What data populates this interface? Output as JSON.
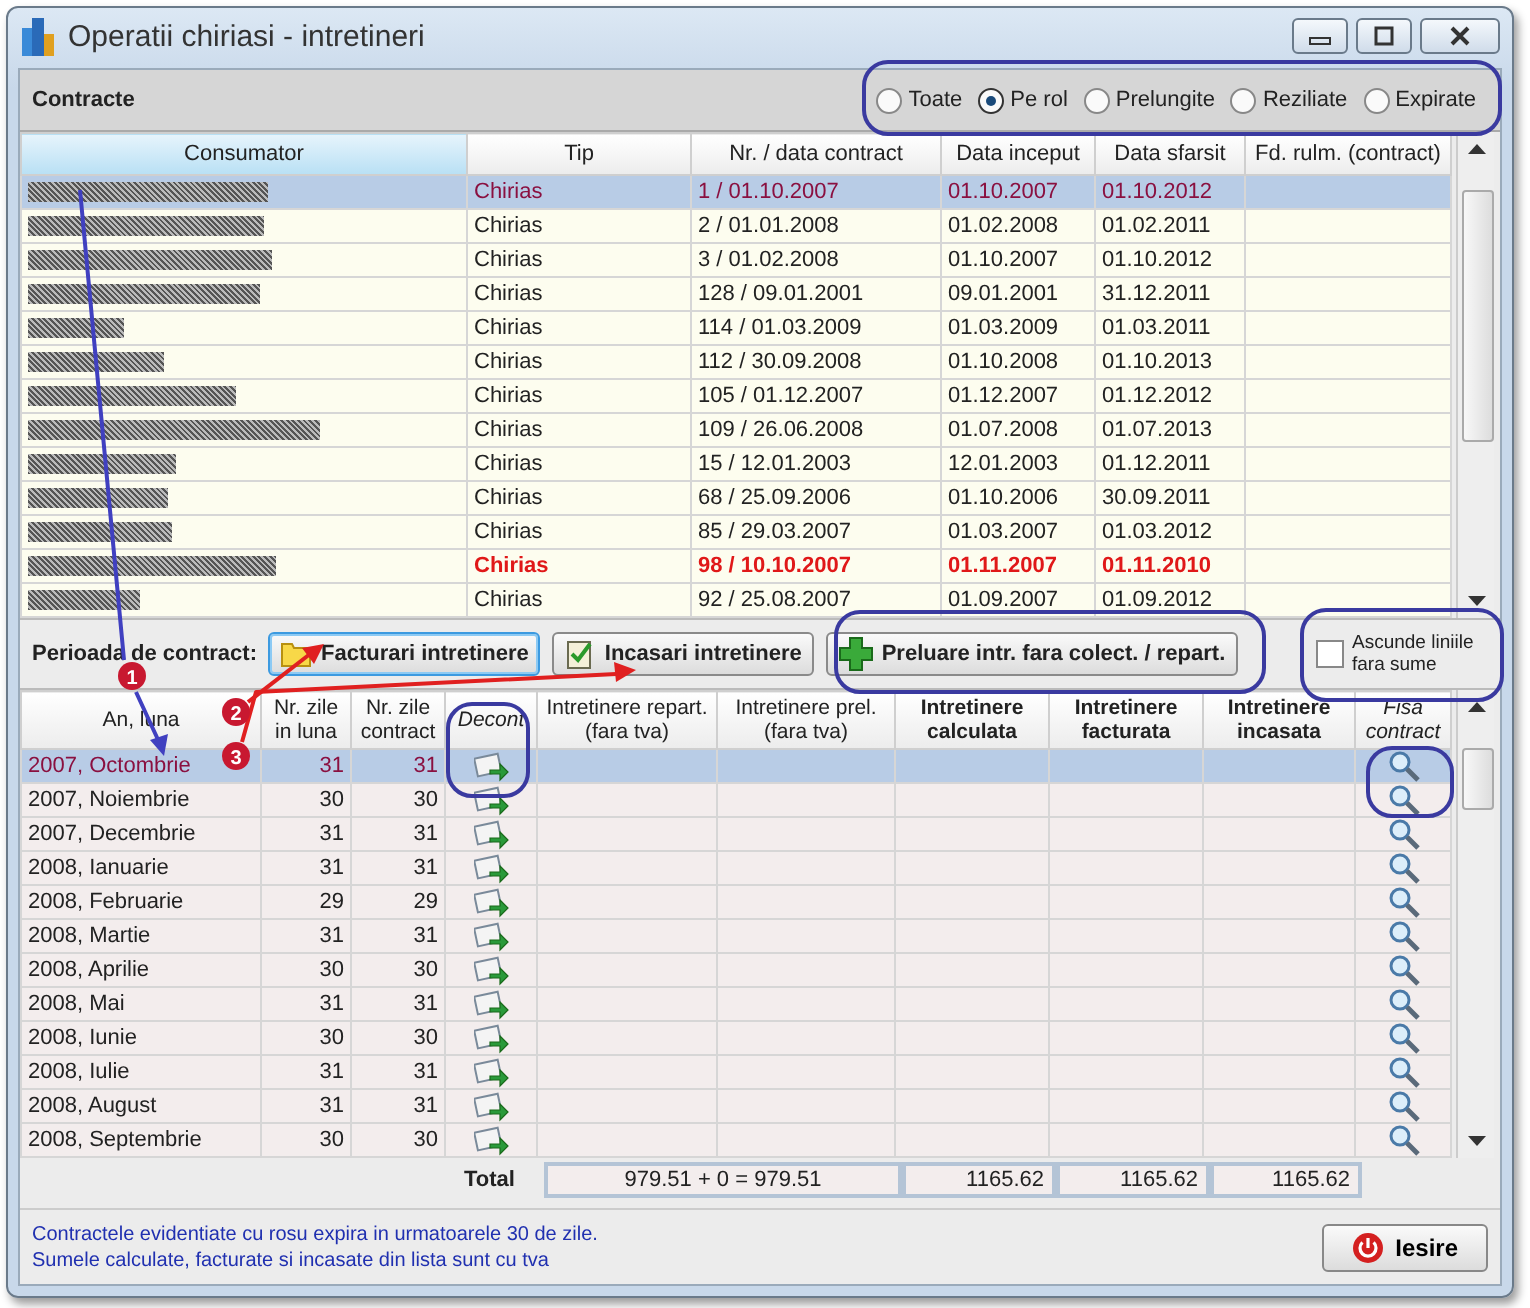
{
  "window": {
    "title": "Operatii chiriasi - intretineri"
  },
  "contracts_panel": {
    "title": "Contracte",
    "filters": [
      {
        "label": "Toate",
        "selected": false
      },
      {
        "label": "Pe rol",
        "selected": true
      },
      {
        "label": "Prelungite",
        "selected": false
      },
      {
        "label": "Reziliate",
        "selected": false
      },
      {
        "label": "Expirate",
        "selected": false
      }
    ]
  },
  "contracts_table": {
    "columns": [
      {
        "label": "Consumator",
        "sorted": true
      },
      {
        "label": "Tip",
        "sorted": false
      },
      {
        "label": "Nr. / data contract",
        "sorted": false
      },
      {
        "label": "Data inceput",
        "sorted": false
      },
      {
        "label": "Data sfarsit",
        "sorted": false
      },
      {
        "label": "Fd. rulm. (contract)",
        "sorted": false
      }
    ],
    "rows": [
      {
        "type": "Chirias",
        "number_date": "1 / 01.10.2007",
        "start": "01.10.2007",
        "end": "01.10.2012",
        "selected": true,
        "expiring": false
      },
      {
        "type": "Chirias",
        "number_date": "2 / 01.01.2008",
        "start": "01.02.2008",
        "end": "01.02.2011",
        "selected": false,
        "expiring": false
      },
      {
        "type": "Chirias",
        "number_date": "3 / 01.02.2008",
        "start": "01.10.2007",
        "end": "01.10.2012",
        "selected": false,
        "expiring": false
      },
      {
        "type": "Chirias",
        "number_date": "128 / 09.01.2001",
        "start": "09.01.2001",
        "end": "31.12.2011",
        "selected": false,
        "expiring": false
      },
      {
        "type": "Chirias",
        "number_date": "114 / 01.03.2009",
        "start": "01.03.2009",
        "end": "01.03.2011",
        "selected": false,
        "expiring": false
      },
      {
        "type": "Chirias",
        "number_date": "112 / 30.09.2008",
        "start": "01.10.2008",
        "end": "01.10.2013",
        "selected": false,
        "expiring": false
      },
      {
        "type": "Chirias",
        "number_date": "105 / 01.12.2007",
        "start": "01.12.2007",
        "end": "01.12.2012",
        "selected": false,
        "expiring": false
      },
      {
        "type": "Chirias",
        "number_date": "109 / 26.06.2008",
        "start": "01.07.2008",
        "end": "01.07.2013",
        "selected": false,
        "expiring": false
      },
      {
        "type": "Chirias",
        "number_date": "15 / 12.01.2003",
        "start": "12.01.2003",
        "end": "01.12.2011",
        "selected": false,
        "expiring": false
      },
      {
        "type": "Chirias",
        "number_date": "68 / 25.09.2006",
        "start": "01.10.2006",
        "end": "30.09.2011",
        "selected": false,
        "expiring": false
      },
      {
        "type": "Chirias",
        "number_date": "85 / 29.03.2007",
        "start": "01.03.2007",
        "end": "01.03.2012",
        "selected": false,
        "expiring": false
      },
      {
        "type": "Chirias",
        "number_date": "98 / 10.10.2007",
        "start": "01.11.2007",
        "end": "01.11.2010",
        "selected": false,
        "expiring": true
      },
      {
        "type": "Chirias",
        "number_date": "92 / 25.08.2007",
        "start": "01.09.2007",
        "end": "01.09.2012",
        "selected": false,
        "expiring": false
      }
    ]
  },
  "period_toolbar": {
    "label": "Perioada de contract:",
    "buttons": [
      {
        "label": "Facturari intretinere",
        "kind": "folder",
        "focused": true
      },
      {
        "label": "Incasari intretinere",
        "kind": "clipboard",
        "focused": false
      },
      {
        "label": "Preluare intr. fara colect. / repart.",
        "kind": "plus",
        "focused": false
      }
    ],
    "hide_empty": {
      "label": "Ascunde liniile fara sume",
      "checked": false
    }
  },
  "months_table": {
    "columns": [
      {
        "label": "An, luna"
      },
      {
        "label": "Nr. zile\nin luna"
      },
      {
        "label": "Nr. zile\ncontract"
      },
      {
        "label": "Decont"
      },
      {
        "label": "Intretinere repart.\n(fara tva)"
      },
      {
        "label": "Intretinere prel.\n(fara tva)"
      },
      {
        "label": "Intretinere\ncalculata"
      },
      {
        "label": "Intretinere\nfacturata"
      },
      {
        "label": "Intretinere\nincasata"
      },
      {
        "label": "Fisa\ncontract"
      }
    ],
    "rows": [
      {
        "month": "2007, Octombrie",
        "days_in_month": "31",
        "days_contract": "31",
        "selected": true
      },
      {
        "month": "2007, Noiembrie",
        "days_in_month": "30",
        "days_contract": "30",
        "selected": false
      },
      {
        "month": "2007, Decembrie",
        "days_in_month": "31",
        "days_contract": "31",
        "selected": false
      },
      {
        "month": "2008, Ianuarie",
        "days_in_month": "31",
        "days_contract": "31",
        "selected": false
      },
      {
        "month": "2008, Februarie",
        "days_in_month": "29",
        "days_contract": "29",
        "selected": false
      },
      {
        "month": "2008, Martie",
        "days_in_month": "31",
        "days_contract": "31",
        "selected": false
      },
      {
        "month": "2008, Aprilie",
        "days_in_month": "30",
        "days_contract": "30",
        "selected": false
      },
      {
        "month": "2008, Mai",
        "days_in_month": "31",
        "days_contract": "31",
        "selected": false
      },
      {
        "month": "2008, Iunie",
        "days_in_month": "30",
        "days_contract": "30",
        "selected": false
      },
      {
        "month": "2008, Iulie",
        "days_in_month": "31",
        "days_contract": "31",
        "selected": false
      },
      {
        "month": "2008, August",
        "days_in_month": "31",
        "days_contract": "31",
        "selected": false
      },
      {
        "month": "2008, Septembrie",
        "days_in_month": "30",
        "days_contract": "30",
        "selected": false
      }
    ],
    "totals": {
      "label": "Total",
      "repart_prel": "979.51 + 0 = 979.51",
      "calculated": "1165.62",
      "invoiced": "1165.62",
      "collected": "1165.62"
    }
  },
  "footer": {
    "notes": [
      "Contractele evidentiate cu rosu expira in urmatoarele 30 de zile.",
      "Sumele calculate, facturate si incasate din lista sunt cu tva"
    ],
    "exit_button": "Iesire"
  },
  "annotation_markers": [
    "1",
    "2",
    "3"
  ]
}
